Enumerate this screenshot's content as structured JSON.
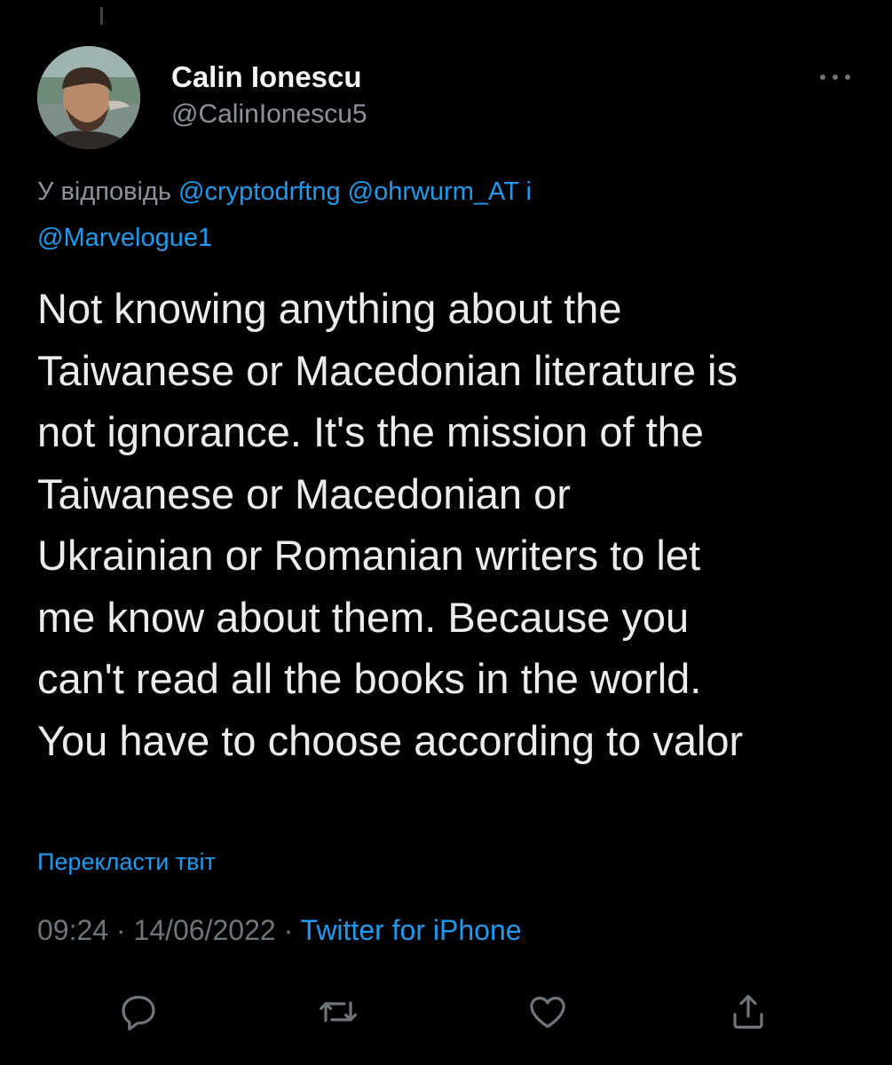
{
  "author": {
    "display_name": "Calin Ionescu",
    "handle": "@CalinIonescu5"
  },
  "reply_context": {
    "prefix": "У відповідь",
    "mention_1": "@cryptodrftng",
    "mention_2": "@ohrwurm_AT",
    "conjunction": "і",
    "mention_3": "@Marvelogue1"
  },
  "tweet": {
    "lines": [
      "Not knowing anything about the",
      "Taiwanese or Macedonian literature is",
      "not ignorance. It's the mission of the",
      "Taiwanese or Macedonian or",
      "Ukrainian or Romanian writers to let",
      "me know about them. Because you",
      "can't read all the books in the world.",
      "You have to choose according to valor"
    ]
  },
  "translate_label": "Перекласти твіт",
  "meta": {
    "time": "09:24",
    "separator": "·",
    "date": "14/06/2022",
    "source": "Twitter for iPhone"
  },
  "icons": {
    "more": "more-horizontal-icon",
    "reply": "reply-bubble-icon",
    "retweet": "retweet-icon",
    "like": "heart-icon",
    "share": "share-icon"
  },
  "colors": {
    "background": "#000000",
    "accent": "#1d9bf0",
    "primary_text": "#e7e9ea",
    "secondary_text": "#8b949c"
  }
}
